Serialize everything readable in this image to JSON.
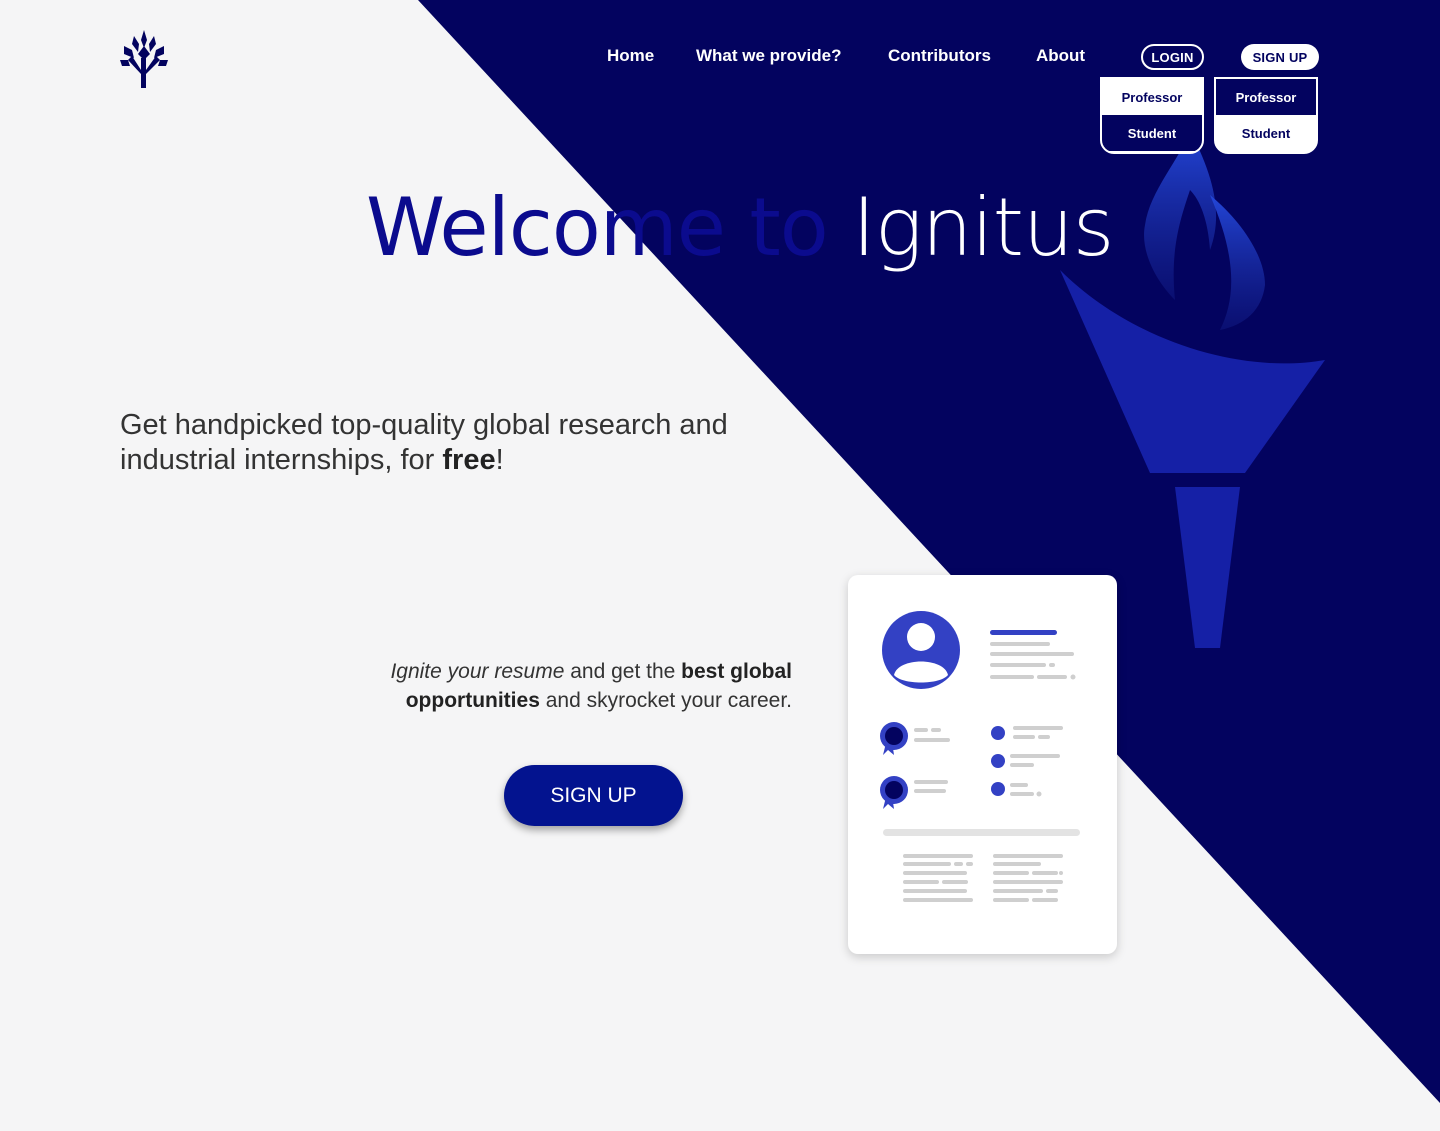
{
  "brand": {
    "logo_icon": "torch-tree-logo-icon",
    "primary_color": "#03035f",
    "accent_color": "#2f3fc4"
  },
  "nav": {
    "links": [
      "Home",
      "What we provide?",
      "Contributors",
      "About"
    ]
  },
  "auth": {
    "login_label": "LOGIN",
    "signup_label": "SIGN UP",
    "login_menu": [
      "Professor",
      "Student"
    ],
    "signup_menu": [
      "Professor",
      "Student"
    ]
  },
  "hero": {
    "title_part1": "Welcome to ",
    "title_part2": "Ignitus",
    "tagline_start": "Get handpicked top-quality global research and industrial internships, for ",
    "tagline_bold": "free",
    "tagline_end": "!",
    "sub_italic": "Ignite your resume",
    "sub_mid": " and get the ",
    "sub_bold": "best global opportunities",
    "sub_end": " and skyrocket your career.",
    "cta_label": "SIGN UP"
  },
  "illustration": {
    "icons": [
      "torch-icon",
      "resume-card-icon",
      "avatar-icon",
      "award-ribbon-icon"
    ]
  }
}
